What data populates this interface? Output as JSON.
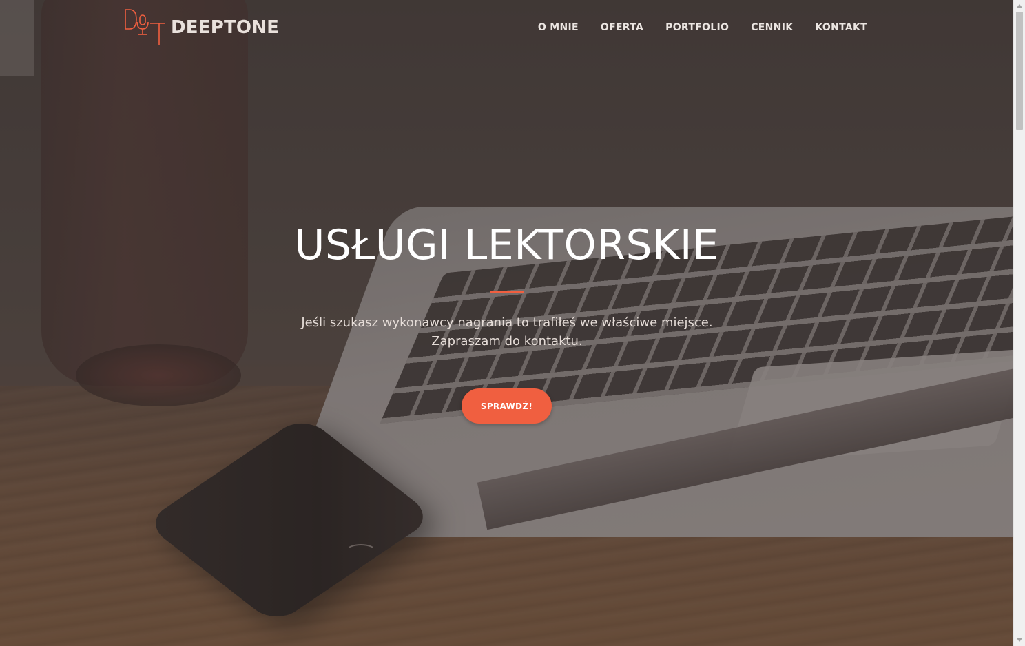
{
  "brand": {
    "name": "DEEPTONE",
    "logo_icon": "microphone-logo-icon",
    "accent_color": "#f05f40"
  },
  "nav": {
    "items": [
      {
        "label": "O MNIE"
      },
      {
        "label": "OFERTA"
      },
      {
        "label": "PORTFOLIO"
      },
      {
        "label": "CENNIK"
      },
      {
        "label": "KONTAKT"
      }
    ]
  },
  "hero": {
    "title": "USŁUGI LEKTORSKIE",
    "subtitle": "Jeśli szukasz wykonawcy nagrania to trafiłeś we właściwe miejsce. Zapraszam do kontaktu.",
    "button_label": "SPRAWDŹ!",
    "background": "laptop-phone-desk-photo"
  }
}
